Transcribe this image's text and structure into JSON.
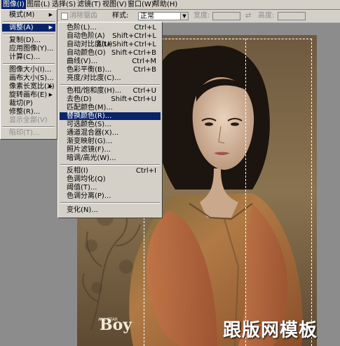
{
  "menubar": {
    "items": [
      "图像(I)",
      "图层(L)",
      "选择(S)",
      "滤镜(T)",
      "视图(V)",
      "窗口(W)",
      "帮助(H)"
    ]
  },
  "options": {
    "checkbox_label": "消除锯齿",
    "style_label": "样式:",
    "style_value": "正常",
    "width_label": "宽度:",
    "height_label": "高度:"
  },
  "image_menu": {
    "items": [
      {
        "label": "模式(M)",
        "submenu": true
      },
      {
        "label": "调整(A)",
        "submenu": true
      },
      {
        "label": "复制(D)..."
      },
      {
        "label": "应用图像(Y)..."
      },
      {
        "label": "计算(C)..."
      },
      {
        "label": "图像大小(I)..."
      },
      {
        "label": "画布大小(S)..."
      },
      {
        "label": "像素长宽比(X)",
        "submenu": true
      },
      {
        "label": "旋转画布(E)",
        "submenu": true
      },
      {
        "label": "裁切(P)"
      },
      {
        "label": "修整(R)..."
      },
      {
        "label": "显示全部(V)"
      },
      {
        "label": "陷印(T)..."
      }
    ],
    "submenu_arrow": "▶"
  },
  "adjust_menu": {
    "items": [
      {
        "label": "色阶(L)...",
        "shortcut": "Ctrl+L"
      },
      {
        "label": "自动色阶(A)",
        "shortcut": "Shift+Ctrl+L"
      },
      {
        "label": "自动对比度(U)",
        "shortcut": "Alt+Shift+Ctrl+L"
      },
      {
        "label": "自动颜色(O)",
        "shortcut": "Shift+Ctrl+B"
      },
      {
        "label": "曲线(V)...",
        "shortcut": "Ctrl+M"
      },
      {
        "label": "色彩平衡(B)...",
        "shortcut": "Ctrl+B"
      },
      {
        "label": "亮度/对比度(C)...",
        "shortcut": ""
      },
      {
        "label": "色相/饱和度(H)...",
        "shortcut": "Ctrl+U"
      },
      {
        "label": "去色(D)",
        "shortcut": "Shift+Ctrl+U"
      },
      {
        "label": "匹配颜色(M)...",
        "shortcut": ""
      },
      {
        "label": "替换颜色(R)...",
        "shortcut": ""
      },
      {
        "label": "可选颜色(S)...",
        "shortcut": ""
      },
      {
        "label": "通道混合器(X)...",
        "shortcut": ""
      },
      {
        "label": "渐变映射(G)...",
        "shortcut": ""
      },
      {
        "label": "照片滤镜(F)...",
        "shortcut": ""
      },
      {
        "label": "暗调/高光(W)...",
        "shortcut": ""
      },
      {
        "label": "反相(I)",
        "shortcut": "Ctrl+I"
      },
      {
        "label": "色调均化(Q)",
        "shortcut": ""
      },
      {
        "label": "阈值(T)...",
        "shortcut": ""
      },
      {
        "label": "色调分离(P)...",
        "shortcut": ""
      },
      {
        "label": "变化(N)...",
        "shortcut": ""
      }
    ]
  },
  "photo": {
    "logo_small": "ALL STAR",
    "logo_text": "Boy"
  },
  "watermark": "跟版网模板",
  "colors": {
    "menu_bg": "#d4d0c8",
    "highlight": "#0a246a",
    "workspace": "#8c8c8c"
  }
}
